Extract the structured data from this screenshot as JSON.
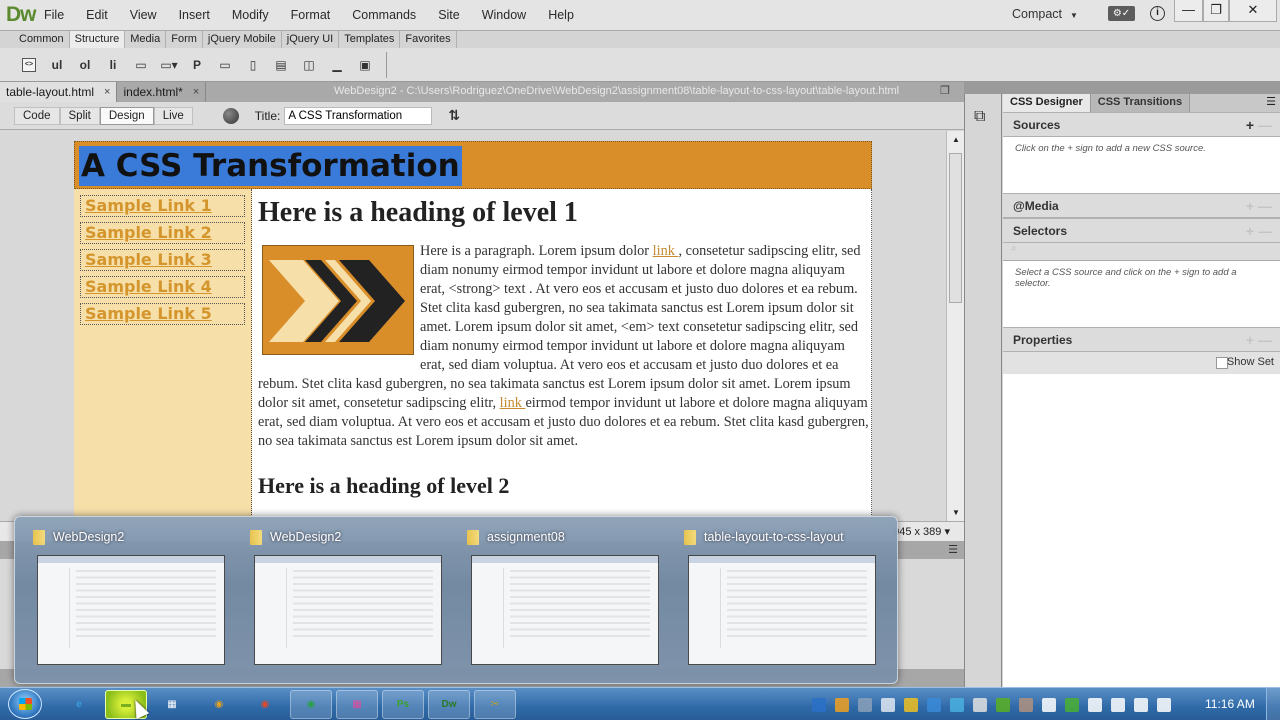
{
  "app": {
    "logo": "Dw",
    "menu": [
      "File",
      "Edit",
      "View",
      "Insert",
      "Modify",
      "Format",
      "Commands",
      "Site",
      "Window",
      "Help"
    ],
    "workspace": "Compact",
    "window_controls": {
      "minimize": "—",
      "restore": "❐",
      "close": "✕"
    }
  },
  "insert_panel": {
    "tabs": [
      {
        "label": "Common",
        "active": false
      },
      {
        "label": "Structure",
        "active": true
      },
      {
        "label": "Media",
        "active": false
      },
      {
        "label": "Form",
        "active": false
      },
      {
        "label": "jQuery Mobile",
        "active": false
      },
      {
        "label": "jQuery UI",
        "active": false
      },
      {
        "label": "Templates",
        "active": false
      },
      {
        "label": "Favorites",
        "active": false
      }
    ],
    "tools": [
      {
        "name": "div-icon",
        "glyph": "<>"
      },
      {
        "name": "ul-icon",
        "glyph": "ul"
      },
      {
        "name": "ol-icon",
        "glyph": "ol"
      },
      {
        "name": "li-icon",
        "glyph": "li"
      },
      {
        "name": "header-icon",
        "glyph": "▭"
      },
      {
        "name": "heading-icon",
        "glyph": "▭▾"
      },
      {
        "name": "paragraph-icon",
        "glyph": "P"
      },
      {
        "name": "navigation-icon",
        "glyph": "▭"
      },
      {
        "name": "aside-icon",
        "glyph": "▯"
      },
      {
        "name": "article-icon",
        "glyph": "▤"
      },
      {
        "name": "section-icon",
        "glyph": "◫"
      },
      {
        "name": "footer-icon",
        "glyph": "▁"
      },
      {
        "name": "figure-icon",
        "glyph": "▣"
      }
    ]
  },
  "documents": {
    "tabs": [
      {
        "label": "table-layout.html",
        "active": true
      },
      {
        "label": "index.html*",
        "active": false
      }
    ],
    "path": "WebDesign2 - C:\\Users\\Rodriguez\\OneDrive\\WebDesign2\\assignment08\\table-layout-to-css-layout\\table-layout.html",
    "close_glyph": "×"
  },
  "doc_toolbar": {
    "views": [
      {
        "label": "Code",
        "active": false
      },
      {
        "label": "Split",
        "active": false
      },
      {
        "label": "Design",
        "active": true
      },
      {
        "label": "Live",
        "active": false
      }
    ],
    "title_label": "Title:",
    "title_value": "A CSS Transformation"
  },
  "page": {
    "title": "A CSS Transformation",
    "sidebar_links": [
      "Sample Link 1",
      "Sample Link 2",
      "Sample Link 3",
      "Sample Link 4",
      "Sample Link 5"
    ],
    "h1": "Here is a heading of level 1",
    "paragraph": {
      "part1": "Here is a paragraph. Lorem ipsum dolor ",
      "link1": "link ",
      "part2": ", consetetur sadipscing elitr, sed diam nonumy eirmod tempor invidunt ut labore et dolore magna aliquyam erat, <strong> text . At vero eos et accusam et justo duo dolores et ea rebum. Stet clita kasd gubergren, no sea takimata sanctus est Lorem ipsum dolor sit amet. Lorem ipsum dolor sit amet, <em> text consetetur sadipscing elitr, sed diam nonumy eirmod tempor invidunt ut labore et dolore magna aliquyam erat, sed diam voluptua. At vero eos et accusam et justo duo dolores et ea rebum. Stet clita kasd gubergren, no sea takimata sanctus est Lorem ipsum dolor sit amet. Lorem ipsum dolor sit amet, consetetur sadipscing elitr, ",
      "link2": "link ",
      "part3": "eirmod tempor invidunt ut labore et dolore magna aliquyam erat, sed diam voluptua. At vero eos et accusam et justo duo dolores et ea rebum. Stet clita kasd gubergren, no sea takimata sanctus est Lorem ipsum dolor sit amet."
    },
    "h2": "Here is a heading of level 2",
    "colors": {
      "header": "#d98e2a",
      "sidebar": "#f6dfa9",
      "link": "#d4962c",
      "selection": "#3a7ad8"
    }
  },
  "status_bar": {
    "window_size": "945 x 389 ▾"
  },
  "css_designer": {
    "tabs": [
      {
        "label": "CSS Designer",
        "active": true
      },
      {
        "label": "CSS Transitions",
        "active": false
      }
    ],
    "sections": {
      "sources": {
        "title": "Sources",
        "hint": "Click on the + sign to add a new CSS source."
      },
      "media": {
        "title": "@Media"
      },
      "selectors": {
        "title": "Selectors",
        "hint": "Select a CSS source and click on the + sign to add a selector."
      },
      "properties": {
        "title": "Properties",
        "show_set": "Show Set"
      }
    }
  },
  "taskbar_preview": {
    "windows": [
      {
        "title": "WebDesign2"
      },
      {
        "title": "WebDesign2"
      },
      {
        "title": "assignment08"
      },
      {
        "title": "table-layout-to-css-layout"
      }
    ]
  },
  "taskbar": {
    "apps": [
      {
        "name": "internet-explorer",
        "glyph": "e",
        "color": "#3b9de0",
        "open": false
      },
      {
        "name": "file-explorer",
        "glyph": "▬",
        "color": "#7ab020",
        "open": true,
        "hover": true
      },
      {
        "name": "apps-grid",
        "glyph": "▦",
        "color": "#ffffff",
        "open": false
      },
      {
        "name": "chrome-1",
        "glyph": "◉",
        "color": "#e0a020",
        "open": false
      },
      {
        "name": "chrome-2",
        "glyph": "◉",
        "color": "#e04a2a",
        "open": false
      },
      {
        "name": "chrome-3",
        "glyph": "◉",
        "color": "#2aa048",
        "open": true
      },
      {
        "name": "windows-store",
        "glyph": "▦",
        "color": "#e04aa0",
        "open": true
      },
      {
        "name": "photoshop",
        "glyph": "Ps",
        "color": "#3aa030",
        "open": true
      },
      {
        "name": "dreamweaver",
        "glyph": "Dw",
        "color": "#2a7a2a",
        "open": true
      },
      {
        "name": "snipping-tool",
        "glyph": "✂",
        "color": "#c0a020",
        "open": true
      }
    ],
    "tray_colors": [
      "#2a70c8",
      "#f0a020",
      "#8aa0b8",
      "#e0e8f0",
      "#f0c020",
      "#3a8ad8",
      "#4ab0e0",
      "#e0e0e0",
      "#5ab020",
      "#b09080",
      "#ffffff",
      "#4ab030",
      "#ffffff",
      "#ffffff",
      "#ffffff",
      "#ffffff"
    ],
    "clock": "11:16 AM"
  }
}
